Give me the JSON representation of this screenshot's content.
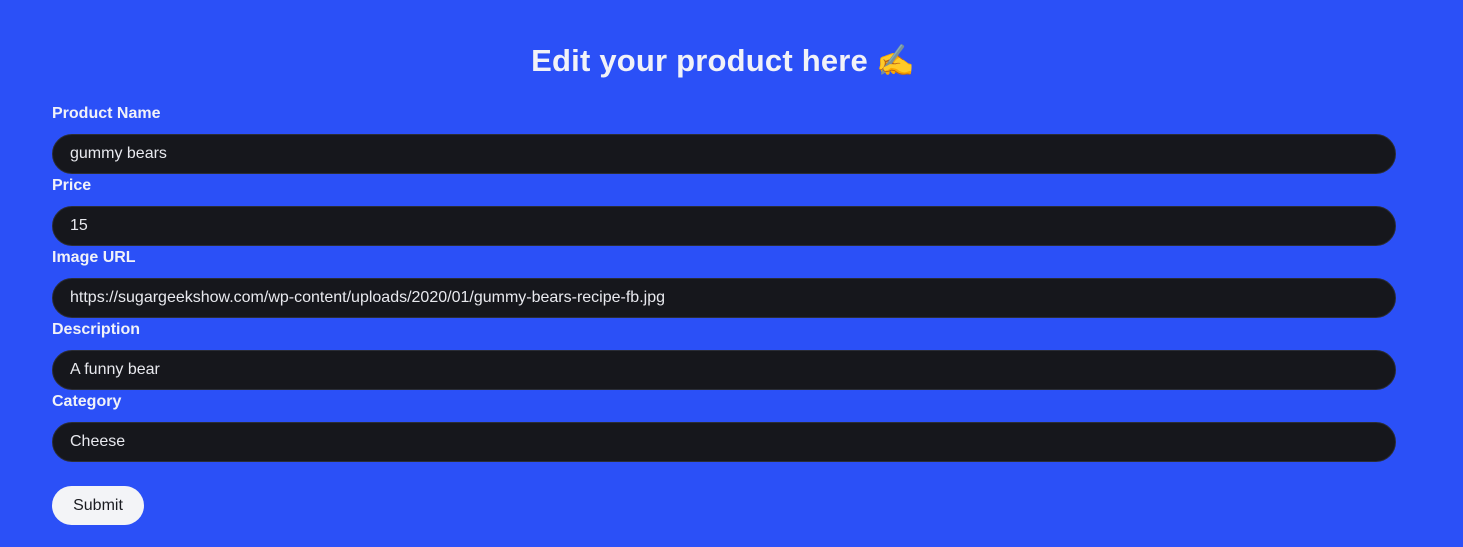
{
  "header": {
    "title": "Edit your product here",
    "title_emoji": "✍️"
  },
  "form": {
    "fields": [
      {
        "label": "Product Name",
        "value": "gummy bears"
      },
      {
        "label": "Price",
        "value": "15"
      },
      {
        "label": "Image URL",
        "value": "https://sugargeekshow.com/wp-content/uploads/2020/01/gummy-bears-recipe-fb.jpg"
      },
      {
        "label": "Description",
        "value": "A funny bear"
      },
      {
        "label": "Category",
        "value": "Cheese"
      }
    ],
    "submit_label": "Submit"
  },
  "colors": {
    "background": "#2b50f7",
    "input_background": "#16171c",
    "button_background": "#f3f4f7"
  }
}
